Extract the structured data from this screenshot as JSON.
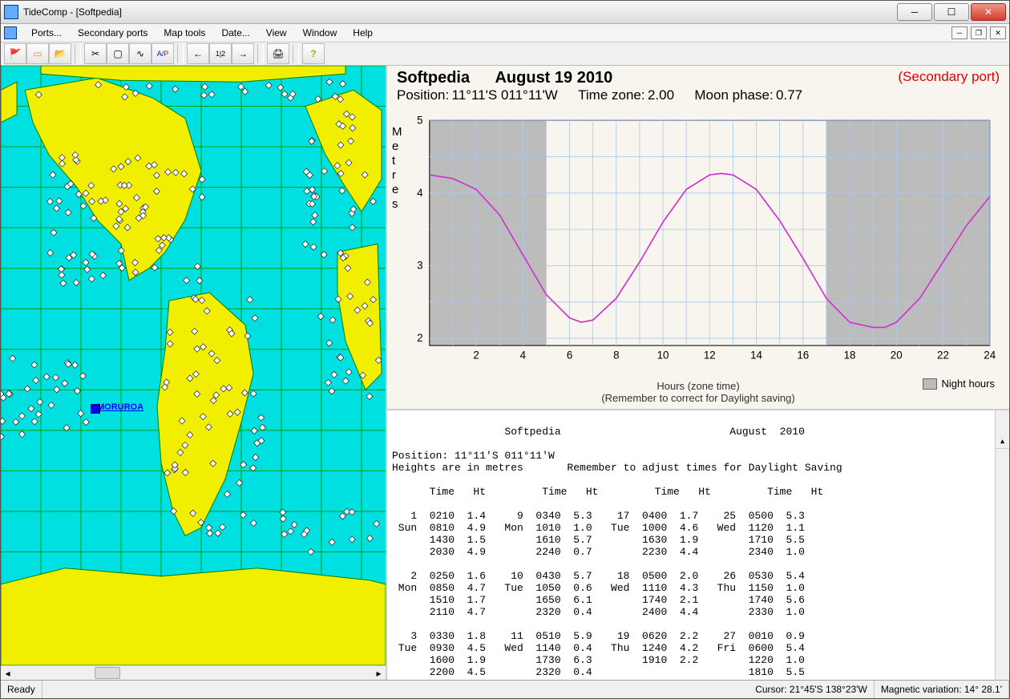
{
  "window": {
    "title": "TideComp - [Softpedia]"
  },
  "menu": [
    "Ports...",
    "Secondary ports",
    "Map tools",
    "Date...",
    "View",
    "Window",
    "Help"
  ],
  "toolbar_icons": [
    "flag-icon",
    "window-icon",
    "open-icon",
    "crop-icon",
    "frame-icon",
    "curve-icon",
    "ap-icon",
    "back-icon",
    "step-icon",
    "forward-icon",
    "print-icon",
    "help-icon"
  ],
  "map": {
    "selected_port_label": "MORUROA"
  },
  "header": {
    "port_name": "Softpedia",
    "date": "August 19 2010",
    "secondary_flag": "(Secondary port)",
    "position_label": "Position:",
    "position_value": "11°11'S 011°11'W",
    "tz_label": "Time zone:",
    "tz_value": " 2.00",
    "moon_label": "Moon phase:",
    "moon_value": "0.77"
  },
  "chart_data": {
    "type": "line",
    "ylabel": "Metres",
    "xlabel": "Hours (zone time)",
    "footnote": "(Remember to correct for Daylight saving)",
    "legend": "Night hours",
    "x_ticks": [
      2,
      4,
      6,
      8,
      10,
      12,
      14,
      16,
      18,
      20,
      22,
      24
    ],
    "y_ticks": [
      2,
      3,
      4,
      5
    ],
    "ylim": [
      1.9,
      5.0
    ],
    "xlim": [
      0,
      24
    ],
    "night_bands": [
      [
        0,
        5
      ],
      [
        17,
        24
      ]
    ],
    "series": [
      {
        "name": "tide",
        "color": "#d030d0",
        "x": [
          0,
          1,
          2,
          3,
          4,
          5,
          6,
          6.5,
          7,
          8,
          9,
          10,
          11,
          12,
          12.5,
          13,
          14,
          15,
          16,
          17,
          18,
          19,
          19.5,
          20,
          21,
          22,
          23,
          24
        ],
        "y": [
          4.25,
          4.2,
          4.05,
          3.7,
          3.15,
          2.6,
          2.28,
          2.22,
          2.25,
          2.55,
          3.05,
          3.6,
          4.05,
          4.25,
          4.27,
          4.25,
          4.05,
          3.62,
          3.1,
          2.55,
          2.22,
          2.15,
          2.15,
          2.22,
          2.55,
          3.05,
          3.55,
          3.95
        ]
      }
    ]
  },
  "tide_table": {
    "title_port": "Softpedia",
    "title_month": "August",
    "title_year": "2010",
    "position_line": "Position: 11°11'S 011°11'W",
    "heights_line": "Heights are in metres       Remember to adjust times for Daylight Saving",
    "col_heads": [
      "Time",
      "Ht",
      "Time",
      "Ht",
      "Time",
      "Ht",
      "Time",
      "Ht"
    ],
    "rows": [
      [
        " 1",
        "0210",
        "1.4",
        "   9",
        "0340",
        "5.3",
        "  17",
        "0400",
        "1.7",
        "  25",
        "0500",
        "5.3"
      ],
      [
        "Sun",
        "0810",
        "4.9",
        " Mon",
        "1010",
        "1.0",
        " Tue",
        "1000",
        "4.6",
        " Wed",
        "1120",
        "1.1"
      ],
      [
        "   ",
        "1430",
        "1.5",
        "    ",
        "1610",
        "5.7",
        "    ",
        "1630",
        "1.9",
        "    ",
        "1710",
        "5.5"
      ],
      [
        "   ",
        "2030",
        "4.9",
        "    ",
        "2240",
        "0.7",
        "    ",
        "2230",
        "4.4",
        "    ",
        "2340",
        "1.0"
      ],
      [
        "",
        "",
        "",
        "",
        "",
        "",
        "",
        "",
        "",
        "",
        "",
        ""
      ],
      [
        " 2",
        "0250",
        "1.6",
        "  10",
        "0430",
        "5.7",
        "  18",
        "0500",
        "2.0",
        "  26",
        "0530",
        "5.4"
      ],
      [
        "Mon",
        "0850",
        "4.7",
        " Tue",
        "1050",
        "0.6",
        " Wed",
        "1110",
        "4.3",
        " Thu",
        "1150",
        "1.0"
      ],
      [
        "   ",
        "1510",
        "1.7",
        "    ",
        "1650",
        "6.1",
        "    ",
        "1740",
        "2.1",
        "    ",
        "1740",
        "5.6"
      ],
      [
        "   ",
        "2110",
        "4.7",
        "    ",
        "2320",
        "0.4",
        "    ",
        "2400",
        "4.4",
        "    ",
        "2330",
        "1.0"
      ],
      [
        "",
        "",
        "",
        "",
        "",
        "",
        "",
        "",
        "",
        "",
        "",
        ""
      ],
      [
        " 3",
        "0330",
        "1.8",
        "  11",
        "0510",
        "5.9",
        "  19",
        "0620",
        "2.2",
        "  27",
        "0010",
        "0.9"
      ],
      [
        "Tue",
        "0930",
        "4.5",
        " Wed",
        "1140",
        "0.4",
        " Thu",
        "1240",
        "4.2",
        " Fri",
        "0600",
        "5.4"
      ],
      [
        "   ",
        "1600",
        "1.9",
        "    ",
        "1730",
        "6.3",
        "    ",
        "1910",
        "2.2",
        "    ",
        "1220",
        "1.0"
      ],
      [
        "   ",
        "2200",
        "4.5",
        "    ",
        "2320",
        "0.4",
        "    ",
        "    ",
        "   ",
        "    ",
        "1810",
        "5.5"
      ]
    ]
  },
  "status": {
    "ready": "Ready",
    "cursor": "Cursor: 21°45'S  138°23'W",
    "magvar": "Magnetic variation:  14° 28.1'"
  }
}
